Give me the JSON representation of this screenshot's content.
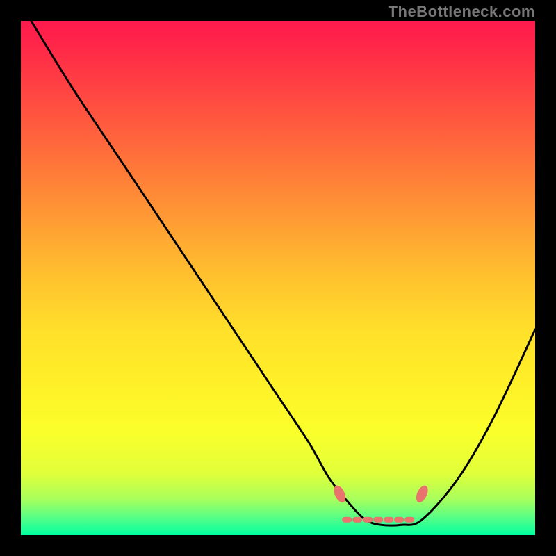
{
  "watermark": "TheBottleneck.com",
  "chart_data": {
    "type": "line",
    "title": "",
    "xlabel": "",
    "ylabel": "",
    "xlim": [
      0,
      100
    ],
    "ylim": [
      0,
      100
    ],
    "series": [
      {
        "name": "bottleneck-curve",
        "x": [
          2,
          10,
          20,
          30,
          40,
          50,
          56,
          60,
          64,
          67,
          70,
          74,
          78,
          85,
          92,
          100
        ],
        "y": [
          100,
          87,
          72,
          57,
          42,
          27,
          18,
          11,
          6,
          3,
          2,
          2,
          3,
          11,
          23,
          40
        ]
      }
    ],
    "markers": [
      {
        "name": "left-cap",
        "x": 62,
        "y": 8
      },
      {
        "name": "right-cap",
        "x": 78,
        "y": 8
      }
    ],
    "dashed_segment": {
      "x_range": [
        63,
        77
      ],
      "y": 3
    },
    "colors": {
      "curve": "#000000",
      "marker_fill": "#e8746d",
      "dash": "#e8746d",
      "gradient_top": "#ff1a4d",
      "gradient_bottom": "#00ff9d"
    }
  }
}
